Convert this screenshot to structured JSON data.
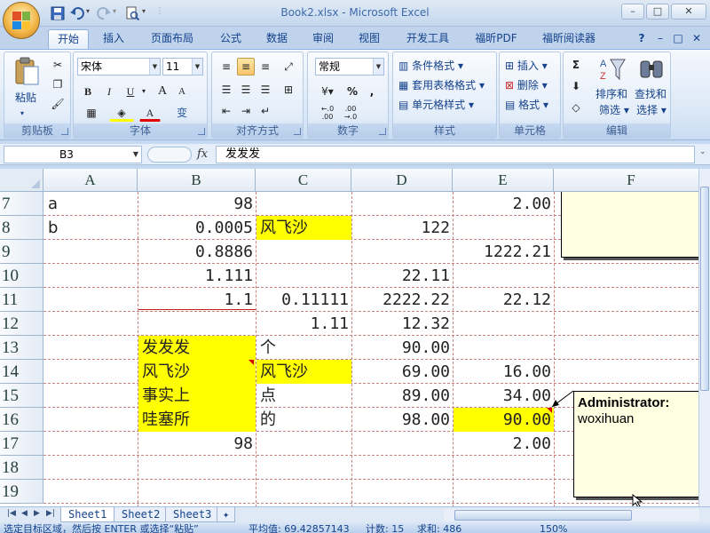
{
  "window": {
    "title": "Book2.xlsx - Microsoft Excel",
    "controls": [
      "–",
      "□",
      "✕"
    ],
    "ribbon_controls": [
      "?",
      "–",
      "□",
      "✕"
    ]
  },
  "ribbon_tabs": [
    "开始",
    "插入",
    "页面布局",
    "公式",
    "数据",
    "审阅",
    "视图",
    "开发工具",
    "福昕PDF",
    "福昕阅读器"
  ],
  "active_tab": "开始",
  "ribbon": {
    "clipboard": {
      "label": "剪贴板",
      "paste": "粘贴"
    },
    "font": {
      "label": "字体",
      "name": "宋体",
      "size": "11",
      "bold": "B",
      "italic": "I",
      "underline": "U",
      "grow": "A",
      "shrink": "A",
      "color_letter": "A",
      "phonetic": "变"
    },
    "alignment": {
      "label": "对齐方式"
    },
    "number": {
      "label": "数字",
      "format": "常规",
      "percent": "%",
      "comma": ",",
      "inc_decimal": ".0\n.00",
      "dec_decimal": ".00\n.0"
    },
    "styles": {
      "label": "样式",
      "conditional": "条件格式",
      "table": "套用表格格式",
      "cell": "单元格样式"
    },
    "cells": {
      "label": "单元格",
      "insert": "插入",
      "delete": "删除",
      "format": "格式"
    },
    "editing": {
      "label": "编辑",
      "sort": "排序和",
      "sort2": "筛选",
      "find": "查找和",
      "find2": "选择",
      "sigma": "Σ"
    }
  },
  "formula_bar": {
    "name_box": "B3",
    "fx": "fx",
    "content": "发发发"
  },
  "columns": [
    "A",
    "B",
    "C",
    "D",
    "E",
    "F"
  ],
  "rows": [
    {
      "num": "7",
      "A": "a",
      "B": "98",
      "C": "",
      "D": "",
      "E": "2.00"
    },
    {
      "num": "8",
      "A": "b",
      "B": "0.0005",
      "C": "风飞沙",
      "D": "122",
      "E": ""
    },
    {
      "num": "9",
      "A": "",
      "B": "0.8886",
      "C": "",
      "D": "",
      "E": "1222.21"
    },
    {
      "num": "10",
      "A": "",
      "B": "1.111",
      "C": "",
      "D": "22.11",
      "E": ""
    },
    {
      "num": "11",
      "A": "",
      "B": "1.1",
      "C": "0.11111",
      "D": "2222.22",
      "E": "22.12"
    },
    {
      "num": "12",
      "A": "",
      "B": "",
      "C": "1.11",
      "D": "12.32",
      "E": ""
    },
    {
      "num": "13",
      "A": "",
      "B": "发发发",
      "C": "个",
      "D": "90.00",
      "E": ""
    },
    {
      "num": "14",
      "A": "",
      "B": "风飞沙",
      "C": "风飞沙",
      "D": "69.00",
      "E": "16.00"
    },
    {
      "num": "15",
      "A": "",
      "B": "事实上",
      "C": "点",
      "D": "89.00",
      "E": "34.00"
    },
    {
      "num": "16",
      "A": "",
      "B": "哇塞所",
      "C": "的",
      "D": "98.00",
      "E": "90.00"
    },
    {
      "num": "17",
      "A": "",
      "B": "98",
      "C": "",
      "D": "",
      "E": "2.00"
    },
    {
      "num": "18",
      "A": "",
      "B": "",
      "C": "",
      "D": "",
      "E": ""
    },
    {
      "num": "19",
      "A": "",
      "B": "",
      "C": "",
      "D": "",
      "E": ""
    }
  ],
  "comment": {
    "author": "Administrator:",
    "text": "woxihuan"
  },
  "sheets": [
    "Sheet1",
    "Sheet2",
    "Sheet3"
  ],
  "active_sheet": "Sheet1",
  "status": {
    "message": "选定目标区域，然后按 ENTER 或选择“粘贴”",
    "average": "平均值: 69.42857143",
    "count": "计数: 15",
    "sum": "求和: 486",
    "zoom": "150%"
  },
  "colors": {
    "highlight": "#ffff00",
    "comment_bg": "#ffffe1"
  }
}
